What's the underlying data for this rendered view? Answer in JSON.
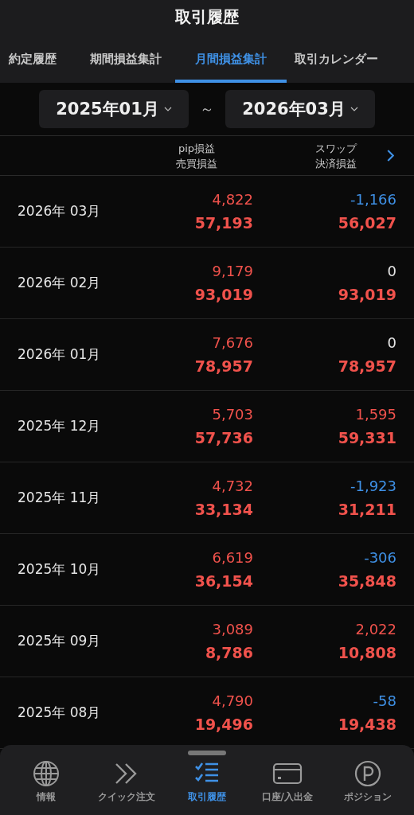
{
  "title": "取引履歴",
  "tabs": [
    {
      "label": "約定履歴",
      "selected": false
    },
    {
      "label": "期間損益集計",
      "selected": false
    },
    {
      "label": "月間損益集計",
      "selected": true
    },
    {
      "label": "取引カレンダー",
      "selected": false
    }
  ],
  "range": {
    "from": "2025年01月",
    "separator": "～",
    "to": "2026年03月"
  },
  "columns": [
    {
      "line_1": "pip損益",
      "line_2": "売買損益"
    },
    {
      "line_1": "スワップ",
      "line_2": "決済損益"
    }
  ],
  "rows": [
    {
      "month": "2026年 03月",
      "pip": {
        "text": "4,822",
        "color": "#f0524c"
      },
      "trade": {
        "text": "57,193",
        "color": "#f0524c"
      },
      "swap": {
        "text": "-1,166",
        "color": "#3f91e6"
      },
      "settle": {
        "text": "56,027",
        "color": "#f0524c"
      }
    },
    {
      "month": "2026年 02月",
      "pip": {
        "text": "9,179",
        "color": "#f0524c"
      },
      "trade": {
        "text": "93,019",
        "color": "#f0524c"
      },
      "swap": {
        "text": "0",
        "color": "#e6e6e6"
      },
      "settle": {
        "text": "93,019",
        "color": "#f0524c"
      }
    },
    {
      "month": "2026年 01月",
      "pip": {
        "text": "7,676",
        "color": "#f0524c"
      },
      "trade": {
        "text": "78,957",
        "color": "#f0524c"
      },
      "swap": {
        "text": "0",
        "color": "#e6e6e6"
      },
      "settle": {
        "text": "78,957",
        "color": "#f0524c"
      }
    },
    {
      "month": "2025年 12月",
      "pip": {
        "text": "5,703",
        "color": "#f0524c"
      },
      "trade": {
        "text": "57,736",
        "color": "#f0524c"
      },
      "swap": {
        "text": "1,595",
        "color": "#f0524c"
      },
      "settle": {
        "text": "59,331",
        "color": "#f0524c"
      }
    },
    {
      "month": "2025年 11月",
      "pip": {
        "text": "4,732",
        "color": "#f0524c"
      },
      "trade": {
        "text": "33,134",
        "color": "#f0524c"
      },
      "swap": {
        "text": "-1,923",
        "color": "#3f91e6"
      },
      "settle": {
        "text": "31,211",
        "color": "#f0524c"
      }
    },
    {
      "month": "2025年 10月",
      "pip": {
        "text": "6,619",
        "color": "#f0524c"
      },
      "trade": {
        "text": "36,154",
        "color": "#f0524c"
      },
      "swap": {
        "text": "-306",
        "color": "#3f91e6"
      },
      "settle": {
        "text": "35,848",
        "color": "#f0524c"
      }
    },
    {
      "month": "2025年 09月",
      "pip": {
        "text": "3,089",
        "color": "#f0524c"
      },
      "trade": {
        "text": "8,786",
        "color": "#f0524c"
      },
      "swap": {
        "text": "2,022",
        "color": "#f0524c"
      },
      "settle": {
        "text": "10,808",
        "color": "#f0524c"
      }
    },
    {
      "month": "2025年 08月",
      "pip": {
        "text": "4,790",
        "color": "#f0524c"
      },
      "trade": {
        "text": "19,496",
        "color": "#f0524c"
      },
      "swap": {
        "text": "-58",
        "color": "#3f91e6"
      },
      "settle": {
        "text": "19,438",
        "color": "#f0524c"
      }
    }
  ],
  "nav": [
    {
      "kind": "globe",
      "label": "情報",
      "selected": false
    },
    {
      "kind": "chevrons",
      "label": "クイック注文",
      "selected": false
    },
    {
      "kind": "checklist",
      "label": "取引履歴",
      "selected": true
    },
    {
      "kind": "card",
      "label": "口座/入出金",
      "selected": false
    },
    {
      "kind": "coin",
      "label": "ポジション",
      "selected": false
    }
  ]
}
